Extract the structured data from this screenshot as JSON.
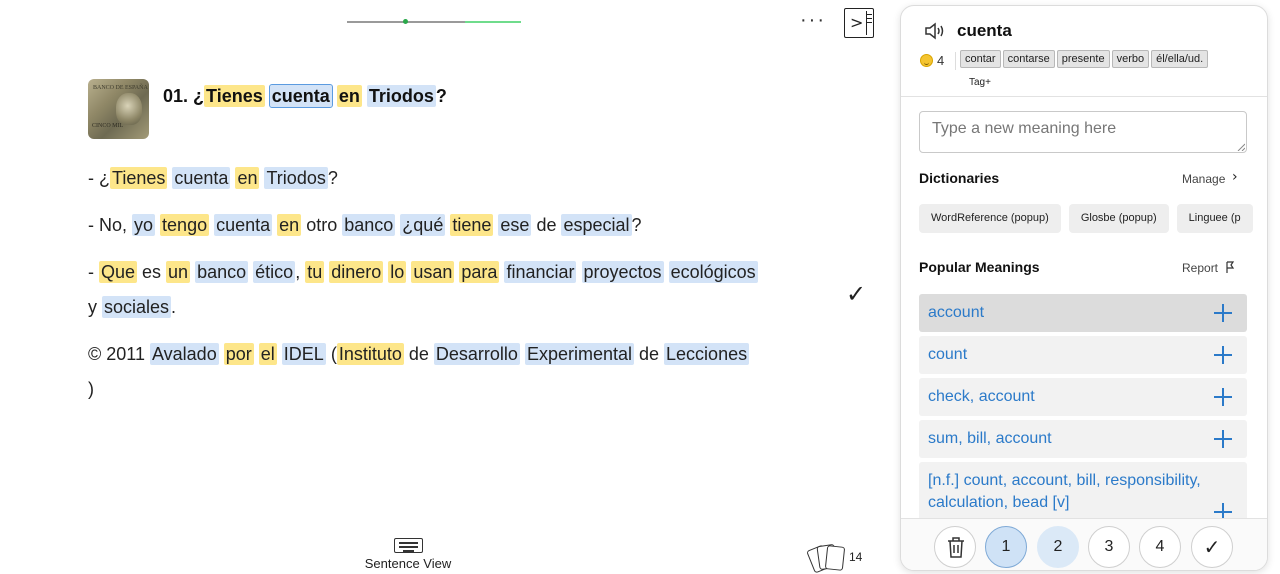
{
  "reader": {
    "progress_percent": 33,
    "title_number": "01.",
    "title_tokens": [
      {
        "t": "¿",
        "h": ""
      },
      {
        "t": "Tienes",
        "h": "y"
      },
      {
        "t": " ",
        "h": ""
      },
      {
        "t": "cuenta",
        "h": "sel"
      },
      {
        "t": " ",
        "h": ""
      },
      {
        "t": "en",
        "h": "y"
      },
      {
        "t": " ",
        "h": ""
      },
      {
        "t": "Triodos",
        "h": "b"
      },
      {
        "t": "?",
        "h": ""
      }
    ],
    "paragraphs": [
      [
        {
          "t": "- ¿",
          "h": ""
        },
        {
          "t": "Tienes",
          "h": "y"
        },
        {
          "t": " ",
          "h": ""
        },
        {
          "t": "cuenta",
          "h": "b"
        },
        {
          "t": " ",
          "h": ""
        },
        {
          "t": "en",
          "h": "y"
        },
        {
          "t": " ",
          "h": ""
        },
        {
          "t": "Triodos",
          "h": "b"
        },
        {
          "t": "?",
          "h": ""
        }
      ],
      [
        {
          "t": "- No, ",
          "h": ""
        },
        {
          "t": "yo",
          "h": "b"
        },
        {
          "t": " ",
          "h": ""
        },
        {
          "t": "tengo",
          "h": "y"
        },
        {
          "t": " ",
          "h": ""
        },
        {
          "t": "cuenta",
          "h": "b"
        },
        {
          "t": " ",
          "h": ""
        },
        {
          "t": "en",
          "h": "y"
        },
        {
          "t": " otro ",
          "h": ""
        },
        {
          "t": "banco",
          "h": "b"
        },
        {
          "t": " ",
          "h": ""
        },
        {
          "t": "¿qué",
          "h": "b"
        },
        {
          "t": " ",
          "h": ""
        },
        {
          "t": "tiene",
          "h": "y"
        },
        {
          "t": " ",
          "h": ""
        },
        {
          "t": "ese",
          "h": "b"
        },
        {
          "t": " de ",
          "h": ""
        },
        {
          "t": "especial",
          "h": "b"
        },
        {
          "t": "?",
          "h": ""
        }
      ],
      [
        {
          "t": "- ",
          "h": ""
        },
        {
          "t": "Que",
          "h": "y"
        },
        {
          "t": " es ",
          "h": ""
        },
        {
          "t": "un",
          "h": "y"
        },
        {
          "t": " ",
          "h": ""
        },
        {
          "t": "banco",
          "h": "b"
        },
        {
          "t": " ",
          "h": ""
        },
        {
          "t": "ético",
          "h": "b"
        },
        {
          "t": ", ",
          "h": ""
        },
        {
          "t": "tu",
          "h": "y"
        },
        {
          "t": " ",
          "h": ""
        },
        {
          "t": "dinero",
          "h": "y"
        },
        {
          "t": " ",
          "h": ""
        },
        {
          "t": "lo",
          "h": "y"
        },
        {
          "t": " ",
          "h": ""
        },
        {
          "t": "usan",
          "h": "y"
        },
        {
          "t": " ",
          "h": ""
        },
        {
          "t": "para",
          "h": "y"
        },
        {
          "t": " ",
          "h": ""
        },
        {
          "t": "financiar",
          "h": "b"
        },
        {
          "t": " ",
          "h": ""
        },
        {
          "t": "proyectos",
          "h": "b"
        },
        {
          "t": " ",
          "h": ""
        },
        {
          "t": "ecológicos",
          "h": "b"
        }
      ],
      [
        {
          "t": "y ",
          "h": ""
        },
        {
          "t": "sociales",
          "h": "b"
        },
        {
          "t": ".",
          "h": ""
        }
      ],
      [
        {
          "t": "© 2011 ",
          "h": ""
        },
        {
          "t": "Avalado",
          "h": "b"
        },
        {
          "t": " ",
          "h": ""
        },
        {
          "t": "por",
          "h": "y"
        },
        {
          "t": " ",
          "h": ""
        },
        {
          "t": "el",
          "h": "y"
        },
        {
          "t": " ",
          "h": ""
        },
        {
          "t": "IDEL",
          "h": "b"
        },
        {
          "t": " (",
          "h": ""
        },
        {
          "t": "Instituto",
          "h": "y"
        },
        {
          "t": " de ",
          "h": ""
        },
        {
          "t": "Desarrollo",
          "h": "b"
        },
        {
          "t": " ",
          "h": ""
        },
        {
          "t": "Experimental",
          "h": "b"
        },
        {
          "t": " de ",
          "h": ""
        },
        {
          "t": "Lecciones",
          "h": "b"
        }
      ],
      [
        {
          "t": ")",
          "h": ""
        }
      ]
    ],
    "sentence_view_label": "Sentence View",
    "cards_count": "14",
    "thumbnail_text_top": "BANCO DE ESPAÑA",
    "thumbnail_text_bottom": "CINCO MIL"
  },
  "panel": {
    "term": "cuenta",
    "status_level": "4",
    "tags": [
      "contar",
      "contarse",
      "presente",
      "verbo",
      "él/ella/ud."
    ],
    "tag_add_label": "Tag+",
    "meaning_placeholder": "Type a new meaning here",
    "dictionaries_title": "Dictionaries",
    "manage_label": "Manage",
    "dictionaries": [
      "WordReference (popup)",
      "Glosbe (popup)",
      "Linguee (p"
    ],
    "popular_title": "Popular Meanings",
    "report_label": "Report",
    "meanings": [
      "account",
      "count",
      "check, account",
      "sum, bill, account",
      "[n.f.] count, account, bill, responsibility, calculation, bead [v]"
    ],
    "ratings": [
      "1",
      "2",
      "3",
      "4"
    ],
    "colors": {
      "highlight_known": "#fde68a",
      "highlight_new": "#d3e3f7",
      "link_blue": "#2b7ac9"
    }
  }
}
